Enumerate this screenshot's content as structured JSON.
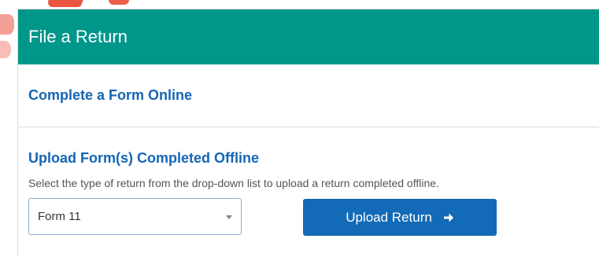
{
  "panel": {
    "title": "File a Return",
    "header_color": "#00978b"
  },
  "online": {
    "link_label": "Complete a Form Online"
  },
  "offline": {
    "heading": "Upload Form(s) Completed Offline",
    "help_text": "Select the type of return from the drop-down list to upload a return completed offline.",
    "select_value": "Form 11",
    "upload_button_label": "Upload Return",
    "upload_button_icon": "arrow-right-icon"
  },
  "colors": {
    "link": "#1565b4",
    "button": "#136ab6"
  }
}
